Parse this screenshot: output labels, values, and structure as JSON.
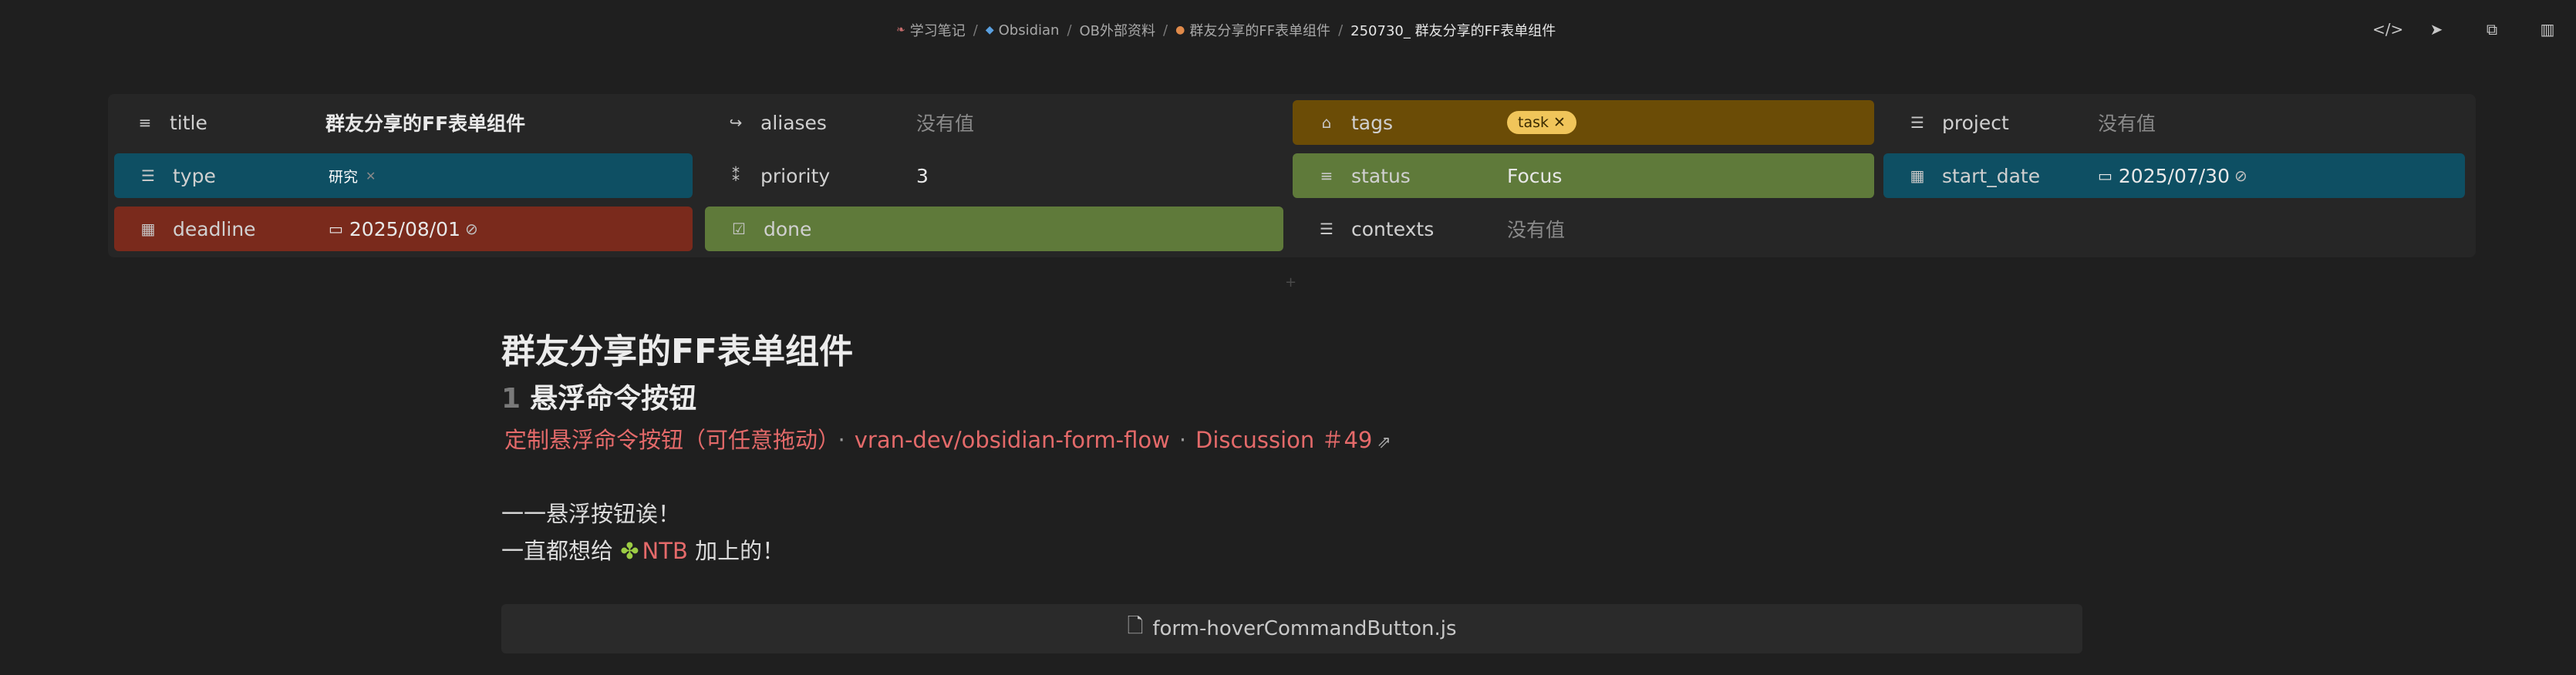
{
  "breadcrumb": {
    "items": [
      {
        "icon": "book-icon",
        "label": "学习笔记"
      },
      {
        "icon": "gem-icon",
        "label": "Obsidian"
      },
      {
        "icon": "",
        "label": "OB外部资料"
      },
      {
        "icon": "fire-icon",
        "label": "群友分享的FF表单组件"
      }
    ],
    "current": "250730_ 群友分享的FF表单组件",
    "separator": "/"
  },
  "top_actions": {
    "source_icon": "</>",
    "send_icon": "➤",
    "folder_icon": "⧉",
    "sidebar_icon": "▥"
  },
  "properties": {
    "title": {
      "name": "title",
      "value": "群友分享的FF表单组件"
    },
    "aliases": {
      "name": "aliases",
      "value": "没有值"
    },
    "tags": {
      "name": "tags",
      "tag": "task"
    },
    "project": {
      "name": "project",
      "value": "没有值"
    },
    "type": {
      "name": "type",
      "tag": "研究"
    },
    "priority": {
      "name": "priority",
      "value": "3"
    },
    "status": {
      "name": "status",
      "value": "Focus"
    },
    "start_date": {
      "name": "start_date",
      "value": "2025/07/30"
    },
    "deadline": {
      "name": "deadline",
      "value": "2025/08/01"
    },
    "done": {
      "name": "done"
    },
    "contexts": {
      "name": "contexts",
      "value": "没有值"
    }
  },
  "colors": {
    "teal": "#0e4f63",
    "amber": "#6b4c06",
    "green": "#5f7a3a",
    "red": "#7a2a1c",
    "link": "#e46a6a"
  },
  "content": {
    "title": "群友分享的FF表单组件",
    "heading_num": "1",
    "heading": "悬浮命令按钮",
    "link_text": "定制悬浮命令按钮（可任意拖动）",
    "link_repo": "vran-dev/obsidian-form-flow",
    "link_discussion": "Discussion ＃49",
    "line1": "一一悬浮按钮诶！",
    "line2_prefix": "一直都想给",
    "line2_link": "NTB",
    "line2_suffix": "加上的！",
    "code_file": "form-hoverCommandButton.js"
  }
}
